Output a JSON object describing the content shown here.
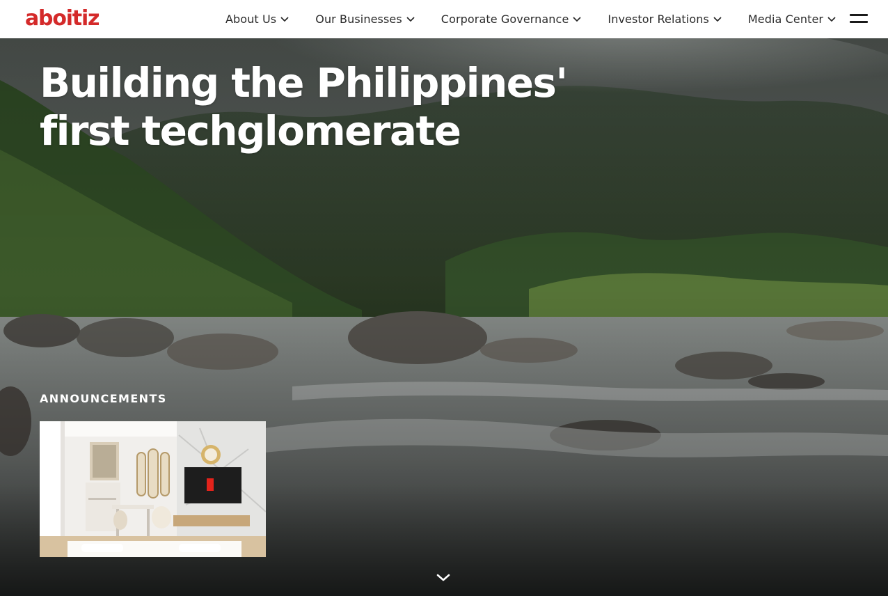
{
  "brand": {
    "name": "aboitiz",
    "color": "#d42a2a"
  },
  "nav": {
    "items": [
      {
        "label": "About Us",
        "icon": "chevron-down-icon"
      },
      {
        "label": "Our Businesses",
        "icon": "chevron-down-icon"
      },
      {
        "label": "Corporate Governance",
        "icon": "chevron-down-icon"
      },
      {
        "label": "Investor Relations",
        "icon": "chevron-down-icon"
      },
      {
        "label": "Media Center",
        "icon": "chevron-down-icon"
      }
    ],
    "menu_icon": "hamburger-menu-icon"
  },
  "hero": {
    "title_line1": "Building the Philippines'",
    "title_line2": "first techglomerate",
    "background": "river-mountain-landscape-photo",
    "scroll_icon": "chevron-down-icon"
  },
  "announcements": {
    "heading": "ANNOUNCEMENTS",
    "card_image": "condo-interior-render-photo"
  }
}
